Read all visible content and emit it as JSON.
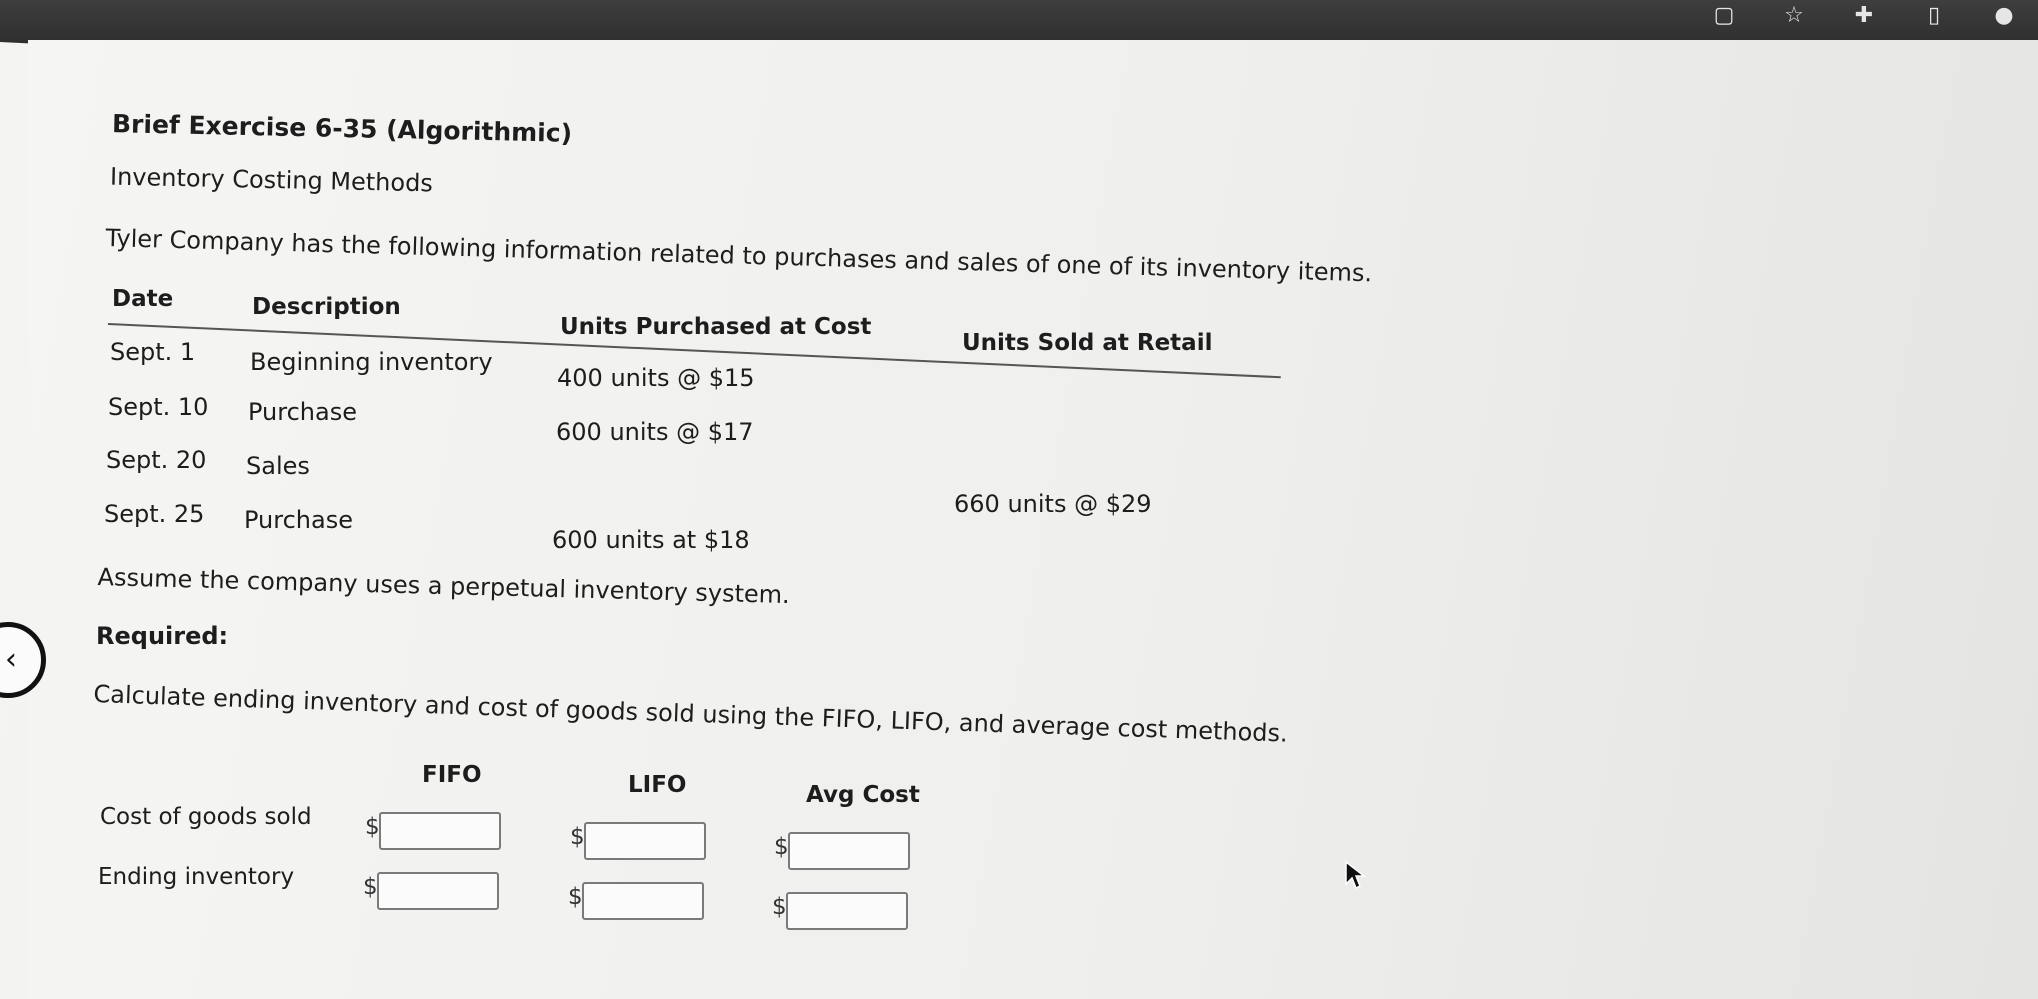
{
  "browser": {
    "toolbar_icons": [
      "tab-icon",
      "star-icon",
      "puzzle-icon",
      "sidebar-icon",
      "profile-icon"
    ]
  },
  "exercise": {
    "title": "Brief Exercise 6-35 (Algorithmic)",
    "subtitle": "Inventory Costing Methods",
    "intro": "Tyler Company has the following information related to purchases and sales of one of its inventory items.",
    "table": {
      "headers": [
        "Date",
        "Description",
        "Units Purchased at Cost",
        "Units Sold at Retail"
      ],
      "rows": [
        {
          "date": "Sept. 1",
          "description": "Beginning inventory",
          "purchased": "400 units @ $15",
          "sold": ""
        },
        {
          "date": "Sept. 10",
          "description": "Purchase",
          "purchased": "600 units @ $17",
          "sold": ""
        },
        {
          "date": "Sept. 20",
          "description": "Sales",
          "purchased": "",
          "sold": "660 units @ $29"
        },
        {
          "date": "Sept. 25",
          "description": "Purchase",
          "purchased": "600 units at $18",
          "sold": ""
        }
      ]
    },
    "assumption": "Assume the company uses a perpetual inventory system.",
    "required_label": "Required:",
    "instruction": "Calculate ending inventory and cost of goods sold using the FIFO, LIFO, and average cost methods."
  },
  "answer_grid": {
    "columns": [
      "FIFO",
      "LIFO",
      "Avg Cost"
    ],
    "currency_symbol": "$",
    "rows": [
      {
        "label": "Cost of goods sold",
        "values": [
          "",
          "",
          ""
        ]
      },
      {
        "label": "Ending inventory",
        "values": [
          "",
          "",
          ""
        ]
      }
    ]
  },
  "navigation": {
    "back_icon": "chevron-left-icon"
  }
}
